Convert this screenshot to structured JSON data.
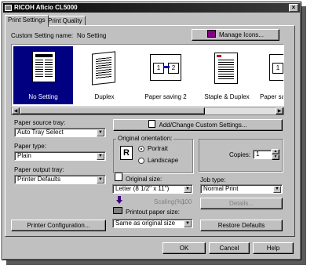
{
  "window": {
    "title": "RICOH Aficio CL5000"
  },
  "tabs": [
    "Print Settings",
    "Print Quality"
  ],
  "custom_setting": {
    "label": "Custom Setting name:",
    "value": "No Setting"
  },
  "manage_icons_label": "Manage Icons...",
  "presets": [
    {
      "label": "No Setting",
      "selected": true
    },
    {
      "label": "Duplex",
      "selected": false
    },
    {
      "label": "Paper saving 2",
      "selected": false
    },
    {
      "label": "Staple & Duplex",
      "selected": false
    },
    {
      "label": "Paper savi",
      "selected": false
    }
  ],
  "add_change_label": "Add/Change Custom Settings...",
  "paper_source": {
    "label": "Paper source tray:",
    "value": "Auto Tray Select"
  },
  "paper_type": {
    "label": "Paper type:",
    "value": "Plain"
  },
  "paper_output": {
    "label": "Paper output tray:",
    "value": "Printer Defaults"
  },
  "orientation": {
    "label": "Original orientation:",
    "portrait": "Portrait",
    "landscape": "Landscape",
    "selected": "Portrait"
  },
  "copies": {
    "label": "Copies:",
    "value": "1"
  },
  "original_size": {
    "label": "Original size:",
    "value": "Letter (8 1/2\" x 11\")"
  },
  "scaling": {
    "label": "Scaling(%):",
    "value": "100"
  },
  "printout_size": {
    "label": "Printout paper size:",
    "value": "Same as original size"
  },
  "job_type": {
    "label": "Job type:",
    "value": "Normal Print"
  },
  "details_label": "Details...",
  "printer_config_label": "Printer Configuration...",
  "restore_defaults_label": "Restore Defaults",
  "footer": {
    "ok": "OK",
    "cancel": "Cancel",
    "help": "Help"
  },
  "colors": {
    "titlebar": "#0a0a0a",
    "face": "#c0c0c0",
    "selected": "#000080"
  }
}
